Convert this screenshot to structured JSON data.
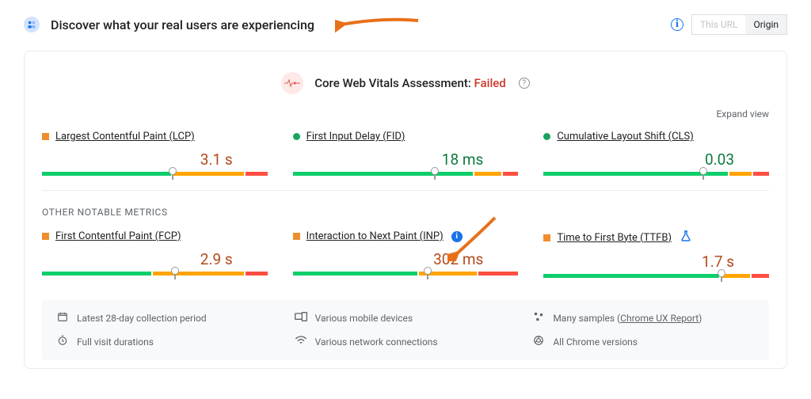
{
  "header": {
    "title": "Discover what your real users are experiencing",
    "toggle": {
      "thisUrl": "This URL",
      "origin": "Origin"
    }
  },
  "assessment": {
    "label": "Core Web Vitals Assessment:",
    "status": "Failed"
  },
  "expand": "Expand view",
  "core": [
    {
      "status": "orange",
      "label": "Largest Contentful Paint (LCP)",
      "value": "3.1 s",
      "value_color": "orange",
      "bar": {
        "g": 58,
        "o": 32,
        "r": 10
      },
      "marker": 58
    },
    {
      "status": "green",
      "label": "First Input Delay (FID)",
      "value": "18 ms",
      "value_color": "green",
      "bar": {
        "g": 81,
        "o": 12,
        "r": 7
      },
      "marker": 63
    },
    {
      "status": "green",
      "label": "Cumulative Layout Shift (CLS)",
      "value": "0.03",
      "value_color": "green",
      "bar": {
        "g": 83,
        "o": 10,
        "r": 7
      },
      "marker": 71
    }
  ],
  "otherLabel": "OTHER NOTABLE METRICS",
  "other": [
    {
      "status": "orange",
      "label": "First Contentful Paint (FCP)",
      "value": "2.9 s",
      "value_color": "orange",
      "bar": {
        "g": 49,
        "o": 41,
        "r": 10
      },
      "marker": 59,
      "badge": null,
      "flask": false
    },
    {
      "status": "orange",
      "label": "Interaction to Next Paint (INP)",
      "value": "302 ms",
      "value_color": "orange",
      "bar": {
        "g": 56,
        "o": 26,
        "r": 18
      },
      "marker": 60,
      "badge": "i",
      "flask": false
    },
    {
      "status": "orange",
      "label": "Time to First Byte (TTFB)",
      "value": "1.7 s",
      "value_color": "orange",
      "bar": {
        "g": 79,
        "o": 13,
        "r": 8
      },
      "marker": 79,
      "badge": null,
      "flask": true
    }
  ],
  "footer": [
    {
      "icon": "calendar",
      "text": "Latest 28-day collection period"
    },
    {
      "icon": "device",
      "text": "Various mobile devices"
    },
    {
      "icon": "samples",
      "textPrefix": "Many samples (",
      "link": "Chrome UX Report",
      "textSuffix": ")"
    },
    {
      "icon": "timer",
      "text": "Full visit durations"
    },
    {
      "icon": "network",
      "text": "Various network connections"
    },
    {
      "icon": "chrome",
      "text": "All Chrome versions"
    }
  ]
}
